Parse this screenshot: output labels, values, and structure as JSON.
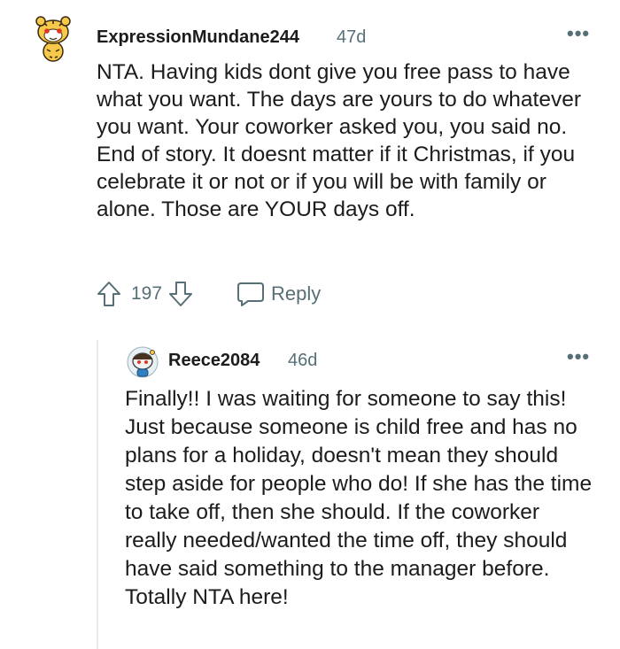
{
  "comments": [
    {
      "username": "ExpressionMundane244",
      "age": "47d",
      "more_icon": "ellipsis-icon",
      "avatar": "snoo-tiger-avatar",
      "body": "NTA. Having kids dont give you free pass to have what you want. The days are yours to do whatever you want. Your coworker asked you, you said no. End of story. It doesnt matter if it Christmas, if you celebrate it or not or if you will be with family or alone. Those are YOUR days off.",
      "votes": "197",
      "reply_label": "Reply"
    },
    {
      "username": "Reece2084",
      "age": "46d",
      "more_icon": "ellipsis-icon",
      "avatar": "snoo-avatar",
      "body": "Finally!! I was waiting for someone to say this! Just because someone is child free and has no plans for a holiday, doesn't mean they should step aside for people who do! If she has the time to take off, then she should. If the coworker really needed/wanted the time off, they should have said something to the manager before. Totally NTA here!"
    }
  ],
  "colors": {
    "text": "#1c1c1c",
    "muted": "#576f76",
    "thread_line": "#e5ebee"
  }
}
